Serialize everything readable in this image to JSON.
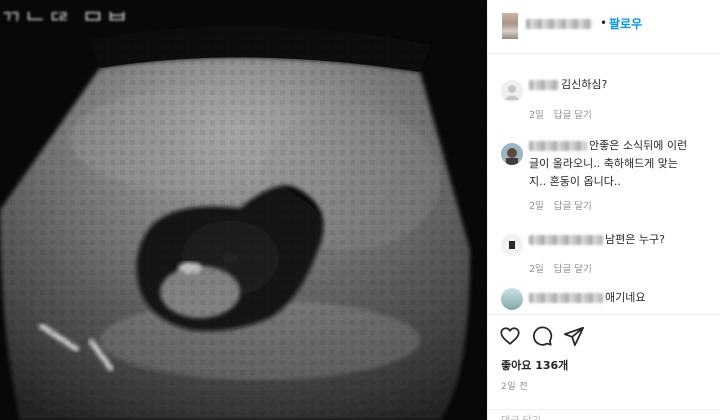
{
  "media": {
    "overlay_text": "ᄁᄂᄃᄅ ᄆᄇ",
    "bg_color": "#000000"
  },
  "header": {
    "username": "",
    "separator": "•",
    "follow_label": "팔로우",
    "follow_color": "#0095f6"
  },
  "comments": [
    {
      "username": "",
      "text": "김신하심?",
      "age": "2일",
      "reply_label": "답글 달기"
    },
    {
      "username": "",
      "text_lines": [
        "안좋은 소식뒤에 이런",
        "글이 올라오니.. 축하해드게 맞는",
        "지.. 혼동이 옵니다.."
      ],
      "age": "2일",
      "reply_label": "답글 달기"
    },
    {
      "username": "",
      "text": "남편은 누구?",
      "age": "2일",
      "reply_label": "답글 달기"
    },
    {
      "username": "",
      "text": "애기네요"
    }
  ],
  "actions": {
    "icons": [
      "heart-icon",
      "comment-icon",
      "share-icon"
    ],
    "likes_text": "좋아요 136개",
    "time_text": "2일 전",
    "add_comment_placeholder": "댓글 달기..."
  }
}
